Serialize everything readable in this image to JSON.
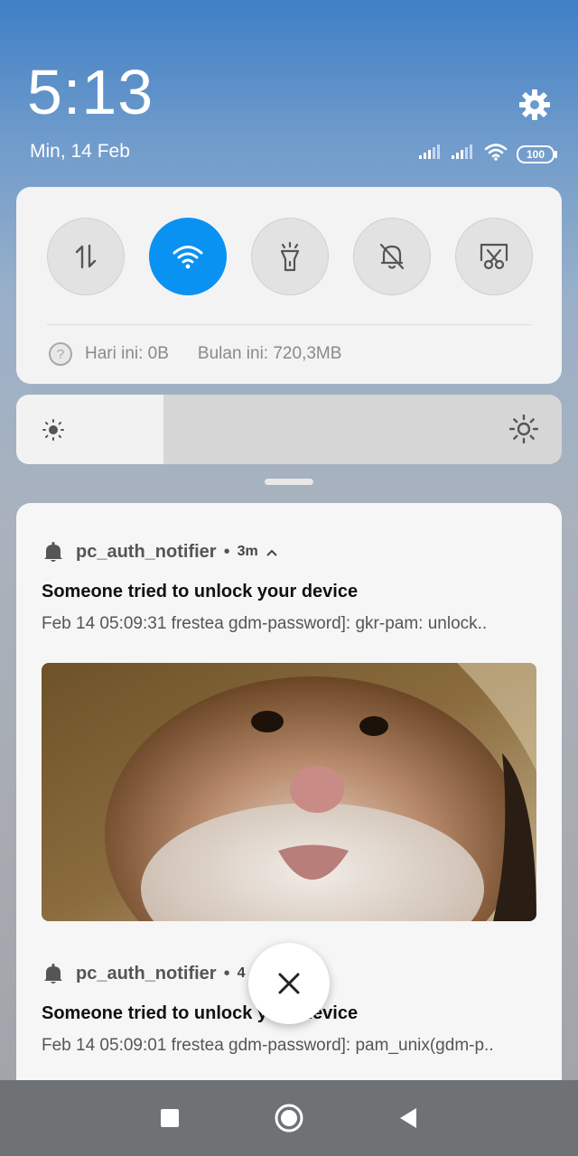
{
  "status": {
    "time": "5:13",
    "date": "Min, 14 Feb",
    "battery": "100"
  },
  "quick_settings": {
    "toggles": [
      {
        "icon": "mobile-data-icon",
        "active": false
      },
      {
        "icon": "wifi-icon",
        "active": true
      },
      {
        "icon": "flashlight-icon",
        "active": false
      },
      {
        "icon": "mute-icon",
        "active": false
      },
      {
        "icon": "screenshot-icon",
        "active": false
      }
    ],
    "today_usage": "Hari ini: 0B",
    "month_usage": "Bulan ini: 720,3MB"
  },
  "brightness": {
    "level_percent": 27
  },
  "notifications": [
    {
      "app": "pc_auth_notifier",
      "time": "3m",
      "title": "Someone tried to unlock your device",
      "body": "Feb 14 05:09:31 frestea gdm-password]: gkr-pam: unlock.."
    },
    {
      "app": "pc_auth_notifier",
      "time": "4",
      "title": "Someone tried to unlock your device",
      "body": "Feb 14 05:09:01 frestea gdm-password]: pam_unix(gdm-p.."
    }
  ],
  "colors": {
    "accent": "#0a92f2",
    "navbar": "#6f7275"
  }
}
